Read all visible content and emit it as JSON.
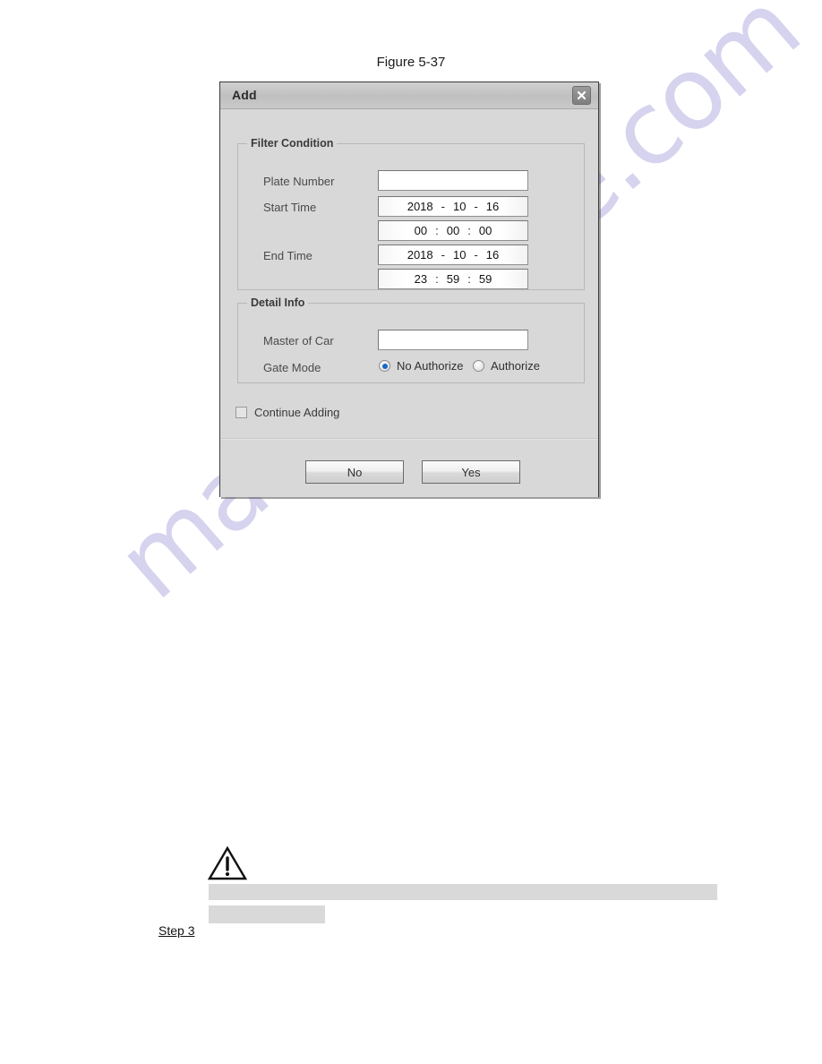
{
  "page": {
    "figure_caption": "Figure 5-37",
    "watermark_text": "manualshive.com",
    "step_label": "Step 3"
  },
  "dialog": {
    "title": "Add",
    "close_icon": "close-icon",
    "groups": {
      "filter": {
        "legend": "Filter Condition",
        "plate_number": {
          "label": "Plate Number",
          "value": "",
          "placeholder": ""
        },
        "start_time": {
          "label": "Start Time",
          "date": {
            "year": "2018",
            "month": "10",
            "day": "16",
            "separator": "-"
          },
          "time": {
            "hour": "00",
            "minute": "00",
            "second": "00",
            "separator": ":"
          }
        },
        "end_time": {
          "label": "End Time",
          "date": {
            "year": "2018",
            "month": "10",
            "day": "16",
            "separator": "-"
          },
          "time": {
            "hour": "23",
            "minute": "59",
            "second": "59",
            "separator": ":"
          }
        }
      },
      "detail": {
        "legend": "Detail Info",
        "master_of_car": {
          "label": "Master of Car",
          "value": "",
          "placeholder": ""
        },
        "gate_mode": {
          "label": "Gate Mode",
          "options": [
            {
              "label": "No Authorize",
              "selected": true
            },
            {
              "label": "Authorize",
              "selected": false
            }
          ]
        }
      }
    },
    "continue_adding": {
      "label": "Continue Adding",
      "checked": false
    },
    "buttons": {
      "no": "No",
      "yes": "Yes"
    }
  },
  "colors": {
    "dialog_bg": "#d8d8d8",
    "titlebar": "#c4c4c4",
    "radio_accent": "#1668c8",
    "redaction_bar": "#d9d9d9",
    "watermark": "#c6c3e8"
  }
}
